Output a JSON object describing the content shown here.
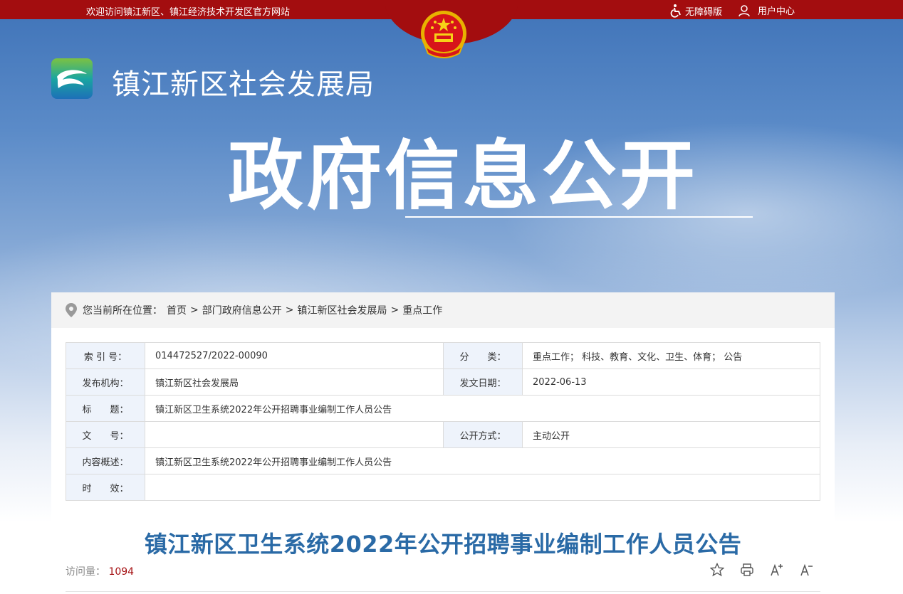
{
  "topbar": {
    "welcome": "欢迎访问镇江新区、镇江经济技术开发区官方网站",
    "accessible": "无障碍版",
    "user_center": "用户中心"
  },
  "header": {
    "org_name": "镇江新区社会发展局",
    "section_title": "政府信息公开"
  },
  "breadcrumb": {
    "prefix": "您当前所在位置：",
    "items": [
      "首页",
      "部门政府信息公开",
      "镇江新区社会发展局",
      "重点工作"
    ],
    "separator": ">"
  },
  "meta": {
    "index_label": "索 引 号：",
    "index_value": "014472527/2022-00090",
    "category_label": "分　　类：",
    "category_value": "重点工作；  科技、教育、文化、卫生、体育；  公告",
    "publisher_label": "发布机构：",
    "publisher_value": "镇江新区社会发展局",
    "date_label": "发文日期：",
    "date_value": "2022-06-13",
    "title_label": "标　　题：",
    "title_value": "镇江新区卫生系统2022年公开招聘事业编制工作人员公告",
    "doc_no_label": "文　　号：",
    "doc_no_value": "",
    "disclosure_label": "公开方式：",
    "disclosure_value": "主动公开",
    "summary_label": "内容概述：",
    "summary_value": "镇江新区卫生系统2022年公开招聘事业编制工作人员公告",
    "validity_label": "时　　效：",
    "validity_value": ""
  },
  "article": {
    "title": "镇江新区卫生系统2022年公开招聘事业编制工作人员公告",
    "visits_label": "访问量：",
    "visits_count": "1094"
  },
  "colors": {
    "topbar_red": "#a30d0f",
    "title_blue": "#2a6aa6"
  }
}
